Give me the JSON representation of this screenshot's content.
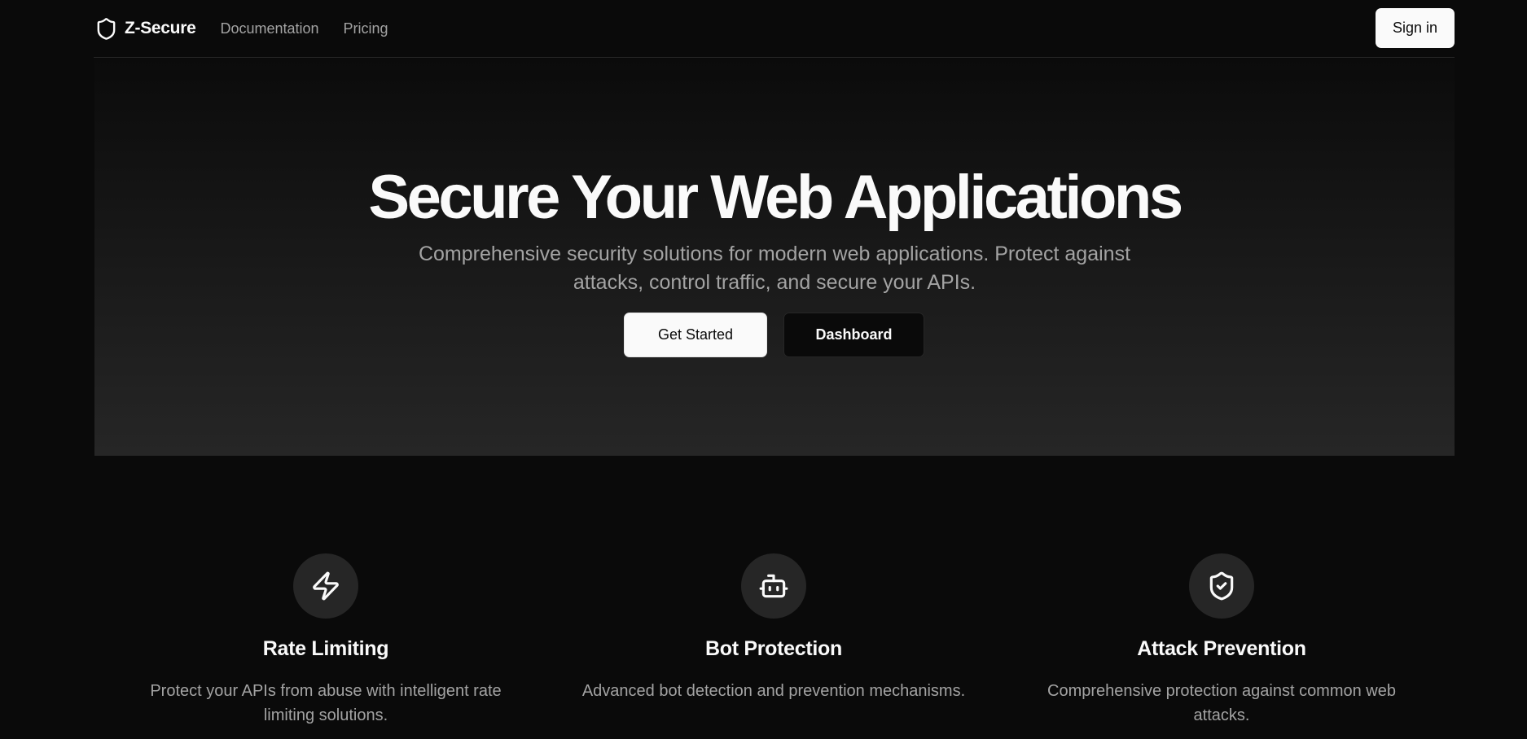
{
  "header": {
    "brand": "Z-Secure",
    "nav": [
      {
        "label": "Documentation"
      },
      {
        "label": "Pricing"
      }
    ],
    "sign_in_label": "Sign in"
  },
  "hero": {
    "title": "Secure Your Web Applications",
    "subtitle": "Comprehensive security solutions for modern web applications. Protect against attacks, control traffic, and secure your APIs.",
    "primary_label": "Get Started",
    "secondary_label": "Dashboard"
  },
  "features": [
    {
      "icon": "lightning-icon",
      "title": "Rate Limiting",
      "description": "Protect your APIs from abuse with intelligent rate limiting solutions."
    },
    {
      "icon": "bot-icon",
      "title": "Bot Protection",
      "description": "Advanced bot detection and prevention mechanisms."
    },
    {
      "icon": "shield-check-icon",
      "title": "Attack Prevention",
      "description": "Comprehensive protection against common web attacks."
    }
  ],
  "colors": {
    "background": "#0a0a0a",
    "foreground": "#fafafa",
    "muted": "#a3a3a3",
    "border": "#262626",
    "icon_circle": "#262626"
  }
}
